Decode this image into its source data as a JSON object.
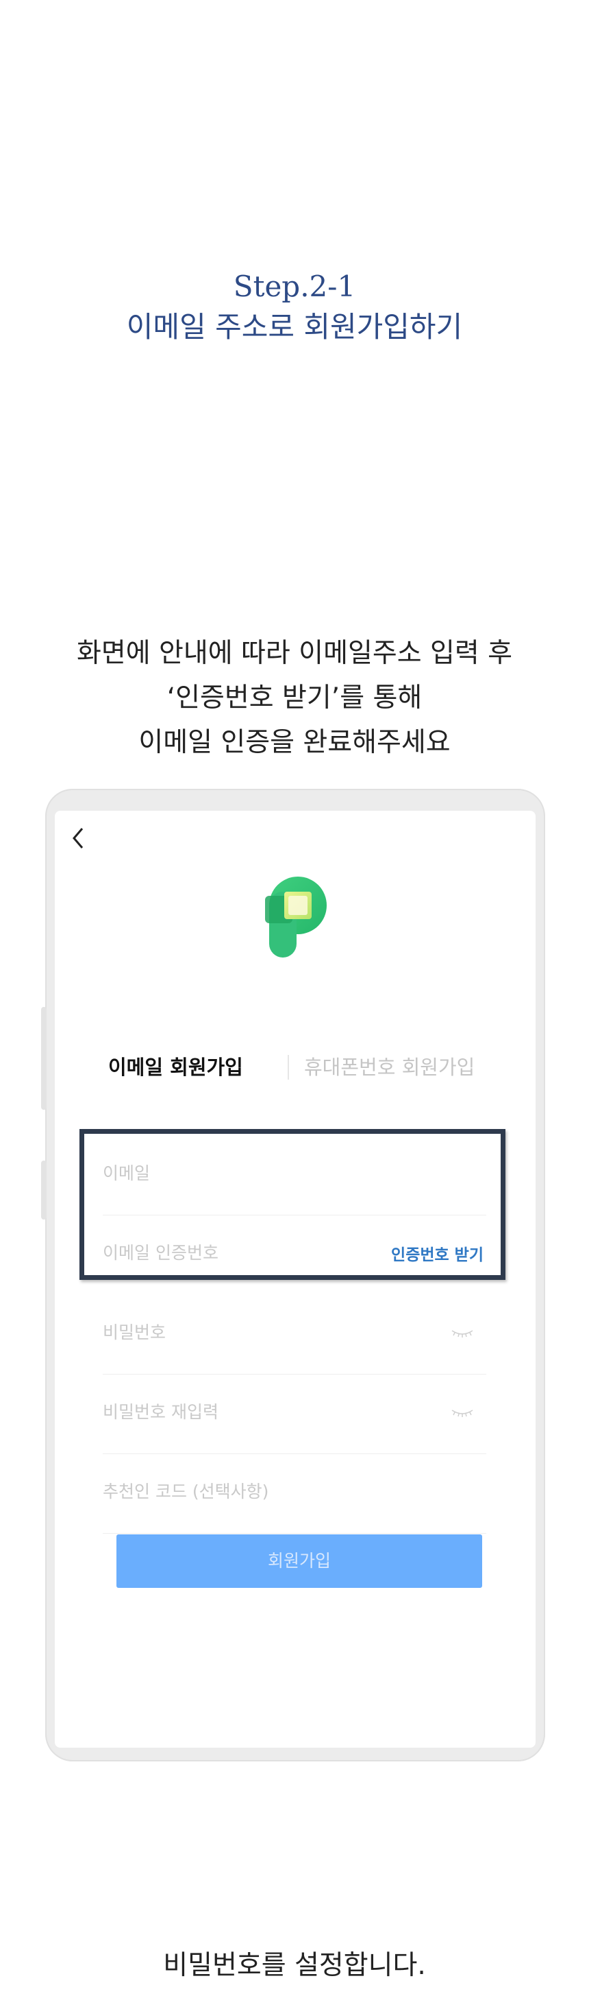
{
  "heading": {
    "step": "Step.2-1",
    "title": "이메일 주소로 회원가입하기"
  },
  "instruction": [
    "화면에 안내에 따라 이메일주소 입력 후",
    "‘인증번호 받기’를 통해",
    "이메일 인증을 완료해주세요"
  ],
  "screen": {
    "tabs": {
      "active": "이메일 회원가입",
      "inactive": "휴대폰번호 회원가입"
    },
    "fields": {
      "email_placeholder": "이메일",
      "code_placeholder": "이메일 인증번호",
      "code_action": "인증번호 받기",
      "password_placeholder": "비밀번호",
      "password_confirm_placeholder": "비밀번호 재입력",
      "referral_placeholder": "추천인 코드 (선택사항)"
    },
    "submit_label": "회원가입",
    "colors": {
      "accent_link": "#2f78c4",
      "button": "#6aaefd",
      "highlight_border": "#2e3a4d",
      "heading": "#2d4a86"
    },
    "icons": [
      "back-chevron-icon",
      "app-logo",
      "eye-closed-icon"
    ]
  },
  "bottom_text": "비밀번호를 설정합니다."
}
